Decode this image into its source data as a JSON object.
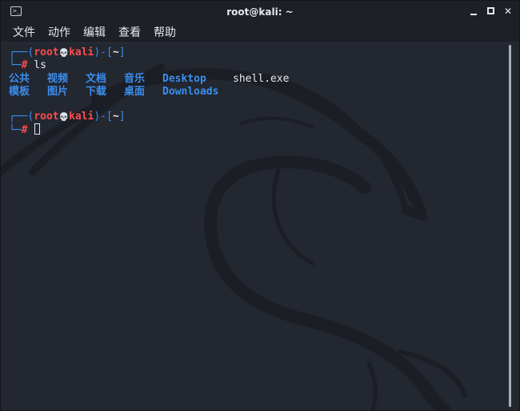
{
  "window": {
    "title": "root@kali: ~",
    "icon": "terminal-icon",
    "icon_glyph": ">_"
  },
  "menubar": {
    "items": [
      "文件",
      "动作",
      "编辑",
      "查看",
      "帮助"
    ]
  },
  "terminal": {
    "prompt1": {
      "open": "┌──(",
      "user": "root",
      "skull": "💀",
      "host": "kali",
      "mid": ")-[",
      "dir": "~",
      "close": "]",
      "lead": "└─",
      "hash": "#",
      "command": " ls"
    },
    "ls_row1": [
      "公共",
      "视频",
      "文档",
      "音乐",
      "Desktop",
      "shell.exe"
    ],
    "ls_row2": [
      "模板",
      "图片",
      "下载",
      "桌面",
      "Downloads"
    ],
    "prompt2": {
      "open": "┌──(",
      "user": "root",
      "skull": "💀",
      "host": "kali",
      "mid": ")-[",
      "dir": "~",
      "close": "]",
      "lead": "└─",
      "hash": "#",
      "command": " "
    }
  },
  "colors": {
    "background": "#232730",
    "prompt_blue": "#3a8ef0",
    "prompt_red": "#ff4d4d",
    "directory": "#3a8ef0",
    "text": "#e6e8ec"
  }
}
